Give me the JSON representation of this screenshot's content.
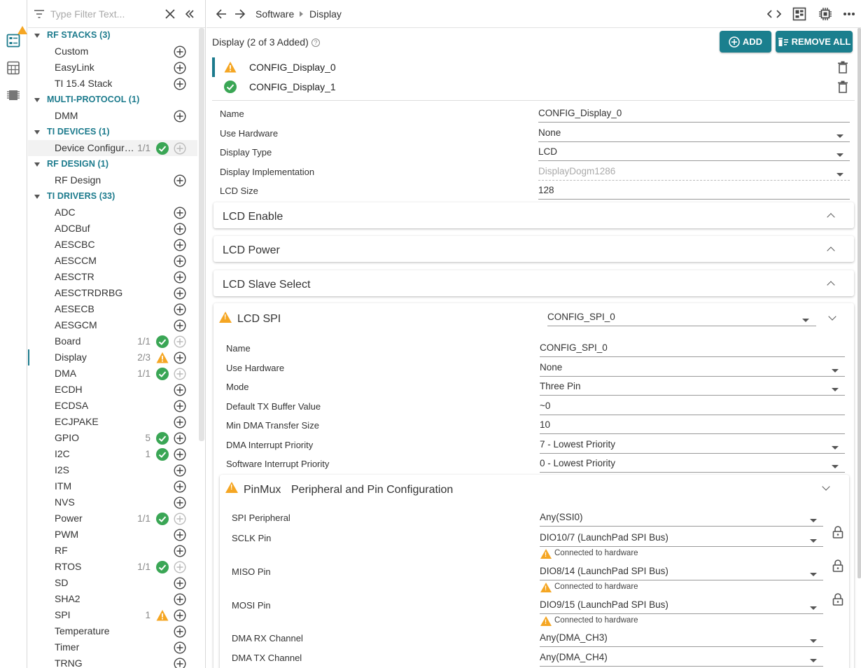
{
  "rail": {
    "icons": [
      "configuration-icon",
      "calculator-icon",
      "chip-icon"
    ]
  },
  "filter": {
    "placeholder": "Type Filter Text..."
  },
  "tree": [
    {
      "type": "cat",
      "label": "RF STACKS (3)"
    },
    {
      "type": "item",
      "label": "Custom"
    },
    {
      "type": "item",
      "label": "EasyLink"
    },
    {
      "type": "item",
      "label": "TI 15.4 Stack"
    },
    {
      "type": "cat",
      "label": "MULTI-PROTOCOL (1)"
    },
    {
      "type": "item",
      "label": "DMM"
    },
    {
      "type": "cat",
      "label": "TI DEVICES (1)"
    },
    {
      "type": "item",
      "label": "Device Configuration",
      "count": "1/1",
      "status": "ok",
      "addDisabled": true,
      "selected": true
    },
    {
      "type": "cat",
      "label": "RF DESIGN (1)"
    },
    {
      "type": "item",
      "label": "RF Design"
    },
    {
      "type": "cat",
      "label": "TI DRIVERS (33)"
    },
    {
      "type": "item",
      "label": "ADC"
    },
    {
      "type": "item",
      "label": "ADCBuf"
    },
    {
      "type": "item",
      "label": "AESCBC"
    },
    {
      "type": "item",
      "label": "AESCCM"
    },
    {
      "type": "item",
      "label": "AESCTR"
    },
    {
      "type": "item",
      "label": "AESCTRDRBG"
    },
    {
      "type": "item",
      "label": "AESECB"
    },
    {
      "type": "item",
      "label": "AESGCM"
    },
    {
      "type": "item",
      "label": "Board",
      "count": "1/1",
      "status": "ok",
      "addDisabled": true
    },
    {
      "type": "item",
      "label": "Display",
      "count": "2/3",
      "status": "warn",
      "active": true
    },
    {
      "type": "item",
      "label": "DMA",
      "count": "1/1",
      "status": "ok",
      "addDisabled": true
    },
    {
      "type": "item",
      "label": "ECDH"
    },
    {
      "type": "item",
      "label": "ECDSA"
    },
    {
      "type": "item",
      "label": "ECJPAKE"
    },
    {
      "type": "item",
      "label": "GPIO",
      "count": "5",
      "status": "ok"
    },
    {
      "type": "item",
      "label": "I2C",
      "count": "1",
      "status": "ok"
    },
    {
      "type": "item",
      "label": "I2S"
    },
    {
      "type": "item",
      "label": "ITM"
    },
    {
      "type": "item",
      "label": "NVS"
    },
    {
      "type": "item",
      "label": "Power",
      "count": "1/1",
      "status": "ok",
      "addDisabled": true
    },
    {
      "type": "item",
      "label": "PWM"
    },
    {
      "type": "item",
      "label": "RF"
    },
    {
      "type": "item",
      "label": "RTOS",
      "count": "1/1",
      "status": "ok",
      "addDisabled": true
    },
    {
      "type": "item",
      "label": "SD"
    },
    {
      "type": "item",
      "label": "SHA2"
    },
    {
      "type": "item",
      "label": "SPI",
      "count": "1",
      "status": "warn"
    },
    {
      "type": "item",
      "label": "Temperature"
    },
    {
      "type": "item",
      "label": "Timer"
    },
    {
      "type": "item",
      "label": "TRNG"
    }
  ],
  "topbar": {
    "crumb1": "Software",
    "crumb2": "Display"
  },
  "module": {
    "title": "Display (2 of 3 Added)",
    "help": "?",
    "add_label": "ADD",
    "remove_label": "REMOVE ALL"
  },
  "instances": [
    {
      "name": "CONFIG_Display_0",
      "status": "warn"
    },
    {
      "name": "CONFIG_Display_1",
      "status": "ok"
    }
  ],
  "fields": [
    {
      "label": "Name",
      "value": "CONFIG_Display_0"
    },
    {
      "label": "Use Hardware",
      "value": "None"
    },
    {
      "label": "Display Type",
      "value": "LCD"
    },
    {
      "label": "Display Implementation",
      "value": "DisplayDogm1286"
    },
    {
      "label": "LCD Size",
      "value": "128"
    }
  ],
  "panels": {
    "enable": "LCD Enable",
    "power": "LCD Power",
    "slave": "LCD Slave Select",
    "spi": {
      "title": "LCD SPI",
      "value": "CONFIG_SPI_0"
    }
  },
  "spi_fields": [
    {
      "label": "Name",
      "value": "CONFIG_SPI_0"
    },
    {
      "label": "Use Hardware",
      "value": "None"
    },
    {
      "label": "Mode",
      "value": "Three Pin"
    },
    {
      "label": "Default TX Buffer Value",
      "value": "~0"
    },
    {
      "label": "Min DMA Transfer Size",
      "value": "10"
    },
    {
      "label": "DMA Interrupt Priority",
      "value": "7 - Lowest Priority"
    },
    {
      "label": "Software Interrupt Priority",
      "value": "0 - Lowest Priority"
    }
  ],
  "pinmux": {
    "title": "PinMux",
    "subtitle": "Peripheral and Pin Configuration",
    "note": "Connected to hardware",
    "fields": [
      {
        "label": "SPI Peripheral",
        "value": "Any(SSI0)"
      },
      {
        "label": "SCLK Pin",
        "value": "DIO10/7 (LaunchPad SPI Bus)"
      },
      {
        "label": "MISO Pin",
        "value": "DIO8/14 (LaunchPad SPI Bus)"
      },
      {
        "label": "MOSI Pin",
        "value": "DIO9/15 (LaunchPad SPI Bus)"
      },
      {
        "label": "DMA RX Channel",
        "value": "Any(DMA_CH3)"
      },
      {
        "label": "DMA TX Channel",
        "value": "Any(DMA_CH4)"
      }
    ]
  },
  "colors": {
    "accent": "#1b7a8c",
    "button": "#1b7f8e",
    "ok": "#3aa655",
    "warn": "#f5a623"
  }
}
